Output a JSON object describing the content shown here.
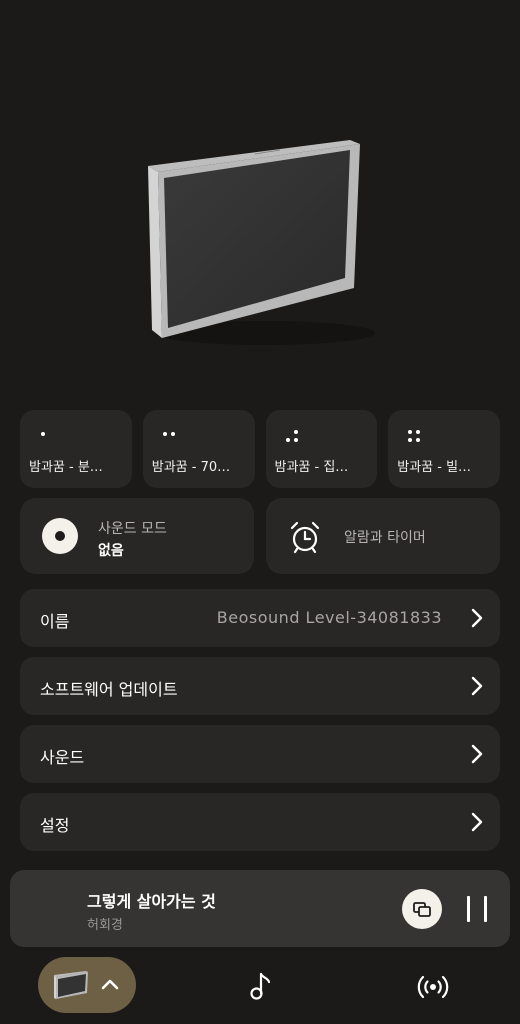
{
  "device": {
    "image": "speaker-image",
    "name_label": "이름",
    "name_value": "Beosound Level-34081833"
  },
  "presets": [
    {
      "dots": 1,
      "label": "밤과꿈 - 분…"
    },
    {
      "dots": 2,
      "label": "밤과꿈 - 70…"
    },
    {
      "dots": 3,
      "label": "밤과꿈 - 집…"
    },
    {
      "dots": 4,
      "label": "밤과꿈 - 빌…"
    }
  ],
  "sound_mode": {
    "title": "사운드 모드",
    "value": "없음",
    "icon": "disc-icon"
  },
  "alarm": {
    "label": "알람과 타이머",
    "icon": "alarm-clock-icon"
  },
  "menu": {
    "software_update": "소프트웨어 업데이트",
    "sound": "사운드",
    "settings": "설정"
  },
  "now_playing": {
    "title": "그렇게 살아가는 것",
    "artist": "허회경",
    "cast_icon": "cast-devices-icon",
    "pause_icon": "pause-icon"
  },
  "nav": {
    "device_icon": "speaker-thumbnail",
    "music_icon": "music-note-icon",
    "radio_icon": "broadcast-icon"
  },
  "colors": {
    "background": "#1b1a18",
    "card": "#282726",
    "player": "#353432",
    "accent_pill": "#6e6045",
    "disc": "#f4f1ea"
  }
}
